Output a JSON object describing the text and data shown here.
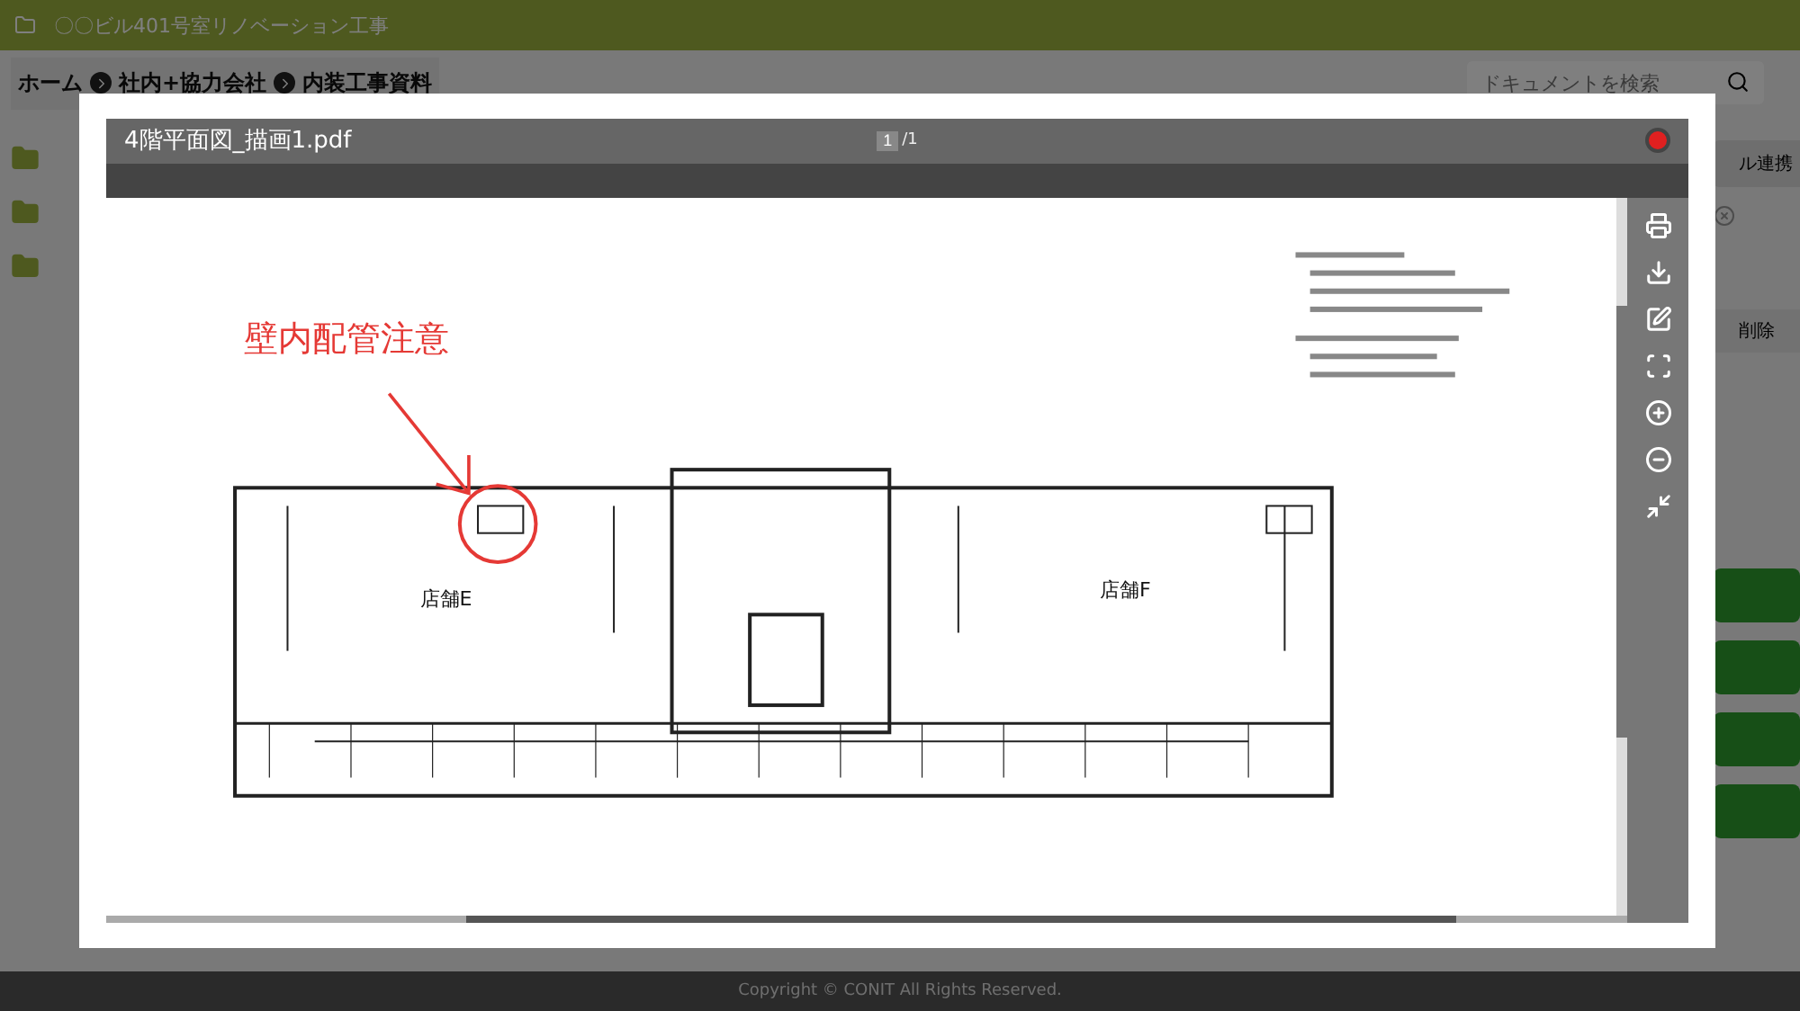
{
  "app": {
    "title": "〇〇ビル401号室リノベーション工事"
  },
  "breadcrumb": [
    {
      "label": "ホーム"
    },
    {
      "label": "社内+協力会社"
    },
    {
      "label": "内装工事資料"
    }
  ],
  "search": {
    "placeholder": "ドキュメントを検索"
  },
  "side_panel": {
    "link_button": "ル連携",
    "delete_button": "削除"
  },
  "viewer": {
    "file_name": "4階平面図_描画1.pdf",
    "page": "1",
    "page_total": "/1",
    "tools": [
      {
        "kind": "print"
      },
      {
        "kind": "download"
      },
      {
        "kind": "edit"
      },
      {
        "kind": "fullscreen"
      },
      {
        "kind": "zoom_in"
      },
      {
        "kind": "zoom_out"
      },
      {
        "kind": "shrink"
      }
    ],
    "annotation": "壁内配管注意",
    "rooms": [
      "店舗E",
      "店舗F"
    ]
  },
  "footer": "Copyright © CONIT All Rights Reserved."
}
